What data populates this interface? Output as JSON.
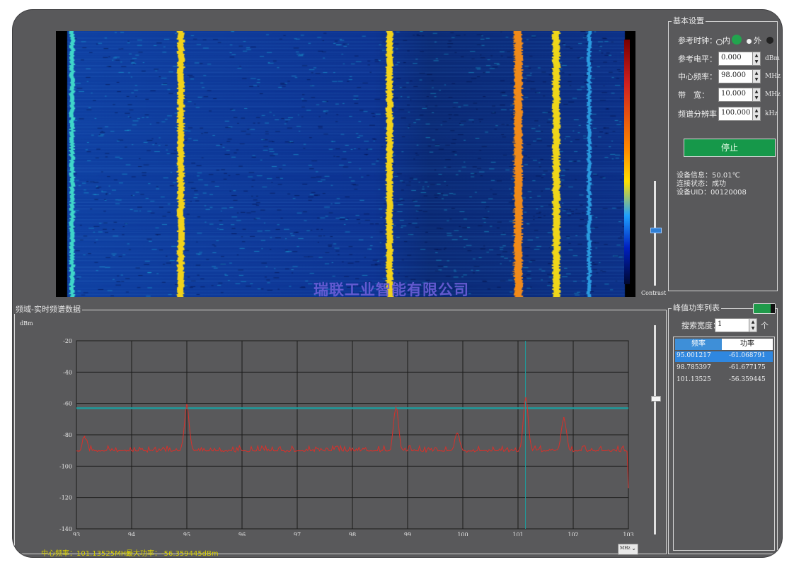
{
  "waterfall": {
    "contrast_label": "Contrast",
    "watermark": "瑞联工业智能有限公司"
  },
  "settings": {
    "title": "基本设置",
    "ref_clock_label": "参考时钟：",
    "ref_clock_internal": "内",
    "ref_clock_external": "外",
    "ref_level_label": "参考电平：",
    "ref_level_value": "0.000",
    "ref_level_unit": "dBm",
    "center_freq_label": "中心频率：",
    "center_freq_value": "98.000",
    "center_freq_unit": "MHz",
    "bandwidth_label": "带　宽：",
    "bandwidth_value": "10.000",
    "bandwidth_unit": "MHz",
    "resolution_label": "频谱分辨率：",
    "resolution_value": "100.000",
    "resolution_unit": "kHz",
    "stop_button": "停止",
    "device_info_1": "设备信息：50.01℃",
    "device_info_2": "连接状态：成功",
    "device_info_3": "设备UID：00120008",
    "accent": "#16984a"
  },
  "spectrum": {
    "title": "频域-实时频谱数据",
    "y_unit": "dBm",
    "unit_select": "MHz",
    "status_center": "中心频率：101.13525MHz",
    "status_max": "最大功率：-56.359445dBm",
    "trace_color": "#d9302a",
    "threshold_color": "#1f9b9b"
  },
  "peaks": {
    "title": "峰值功率列表",
    "search_width_label": "搜索宽度：",
    "search_width_value": "1",
    "search_width_unit": "个",
    "col_freq": "频率",
    "col_power": "功率",
    "rows": [
      {
        "freq": "95.001217",
        "power": "-61.068791"
      },
      {
        "freq": "98.785397",
        "power": "-61.677175"
      },
      {
        "freq": "101.13525",
        "power": "-56.359445"
      }
    ]
  },
  "chart_data": {
    "type": "line",
    "title": "频域-实时频谱数据",
    "xlabel": "",
    "ylabel": "dBm",
    "xlim": [
      93,
      103
    ],
    "ylim": [
      -140,
      -20
    ],
    "x_ticks": [
      "93",
      "94",
      "95",
      "96",
      "97",
      "98",
      "99",
      "100",
      "101",
      "102",
      "103"
    ],
    "y_ticks": [
      "-20",
      "-40",
      "-60",
      "-80",
      "-100",
      "-120",
      "-140"
    ],
    "grid": true,
    "threshold": -63,
    "marker_x": 101.13525,
    "peaks": [
      {
        "x": 93.15,
        "y": -81
      },
      {
        "x": 95.0,
        "y": -61
      },
      {
        "x": 98.79,
        "y": -61.7
      },
      {
        "x": 99.9,
        "y": -79
      },
      {
        "x": 101.14,
        "y": -56.4
      },
      {
        "x": 101.83,
        "y": -69
      }
    ],
    "noise_floor": -91
  }
}
